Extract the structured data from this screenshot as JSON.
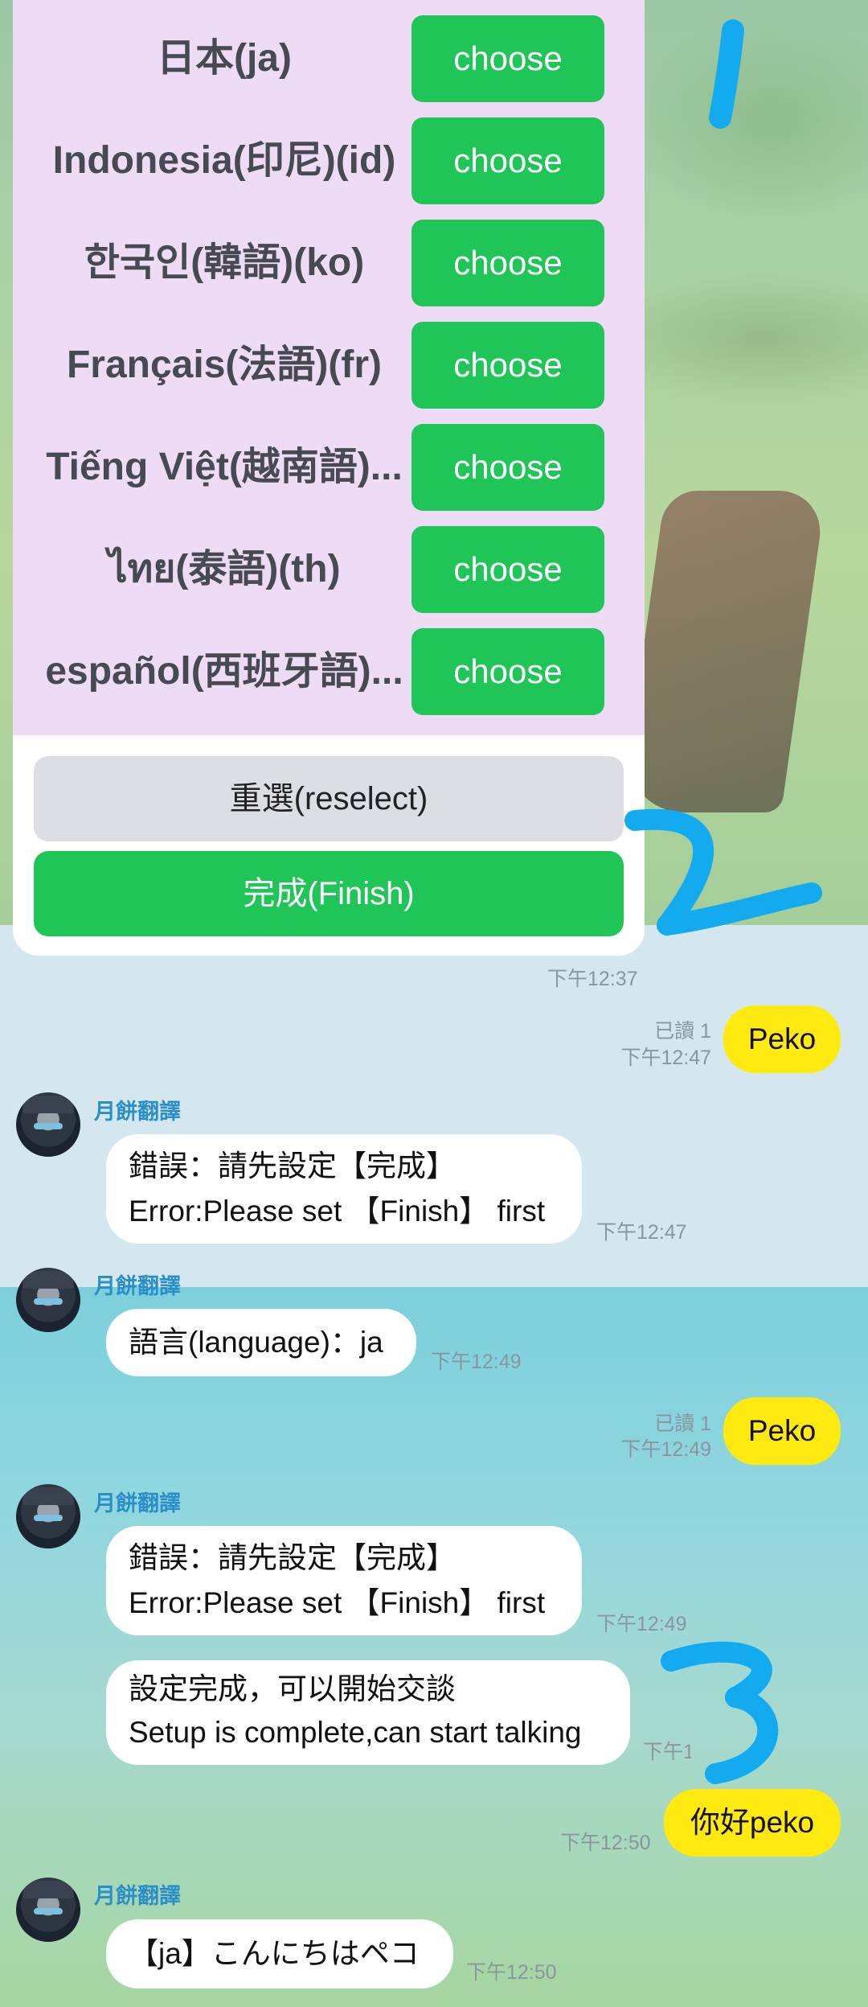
{
  "colors": {
    "accent_green": "#1fc557",
    "panel_lavender": "#eedcf6",
    "bubble_yellow": "#ffe90e",
    "sender_blue": "#2a8fc9"
  },
  "language_list": [
    {
      "name": "日本(ja)",
      "button": "choose"
    },
    {
      "name": "Indonesia(印尼)(id)",
      "button": "choose"
    },
    {
      "name": "한국인(韓語)(ko)",
      "button": "choose"
    },
    {
      "name": "Français(法語)(fr)",
      "button": "choose"
    },
    {
      "name": "Tiếng Việt(越南語)...",
      "button": "choose"
    },
    {
      "name": "ไทย(泰語)(th)",
      "button": "choose"
    },
    {
      "name": "español(西班牙語)...",
      "button": "choose"
    }
  ],
  "actions": {
    "reselect": "重選(reselect)",
    "finish": "完成(Finish)"
  },
  "card_time": "下午12:37",
  "sender_name": "月餅翻譯",
  "messages": [
    {
      "type": "out",
      "text": "Peko",
      "read": "已讀 1",
      "time": "下午12:47"
    },
    {
      "type": "in",
      "line1": "錯誤：請先設定【完成】",
      "line2": "Error:Please set 【Finish】 first",
      "time": "下午12:47"
    },
    {
      "type": "in",
      "line1": "語言(language)：ja",
      "time": "下午12:49"
    },
    {
      "type": "out",
      "text": "Peko",
      "read": "已讀 1",
      "time": "下午12:49"
    },
    {
      "type": "in",
      "line1": "錯誤：請先設定【完成】",
      "line2": "Error:Please set 【Finish】 first",
      "time": "下午12:49"
    },
    {
      "type": "in",
      "line1": "設定完成，可以開始交談",
      "line2": "Setup is complete,can start talking",
      "time": "下午12:49"
    },
    {
      "type": "out",
      "text": "你好peko",
      "time": "下午12:50"
    },
    {
      "type": "in",
      "line1": "【ja】こんにちはペコ",
      "time": "下午12:50"
    }
  ]
}
